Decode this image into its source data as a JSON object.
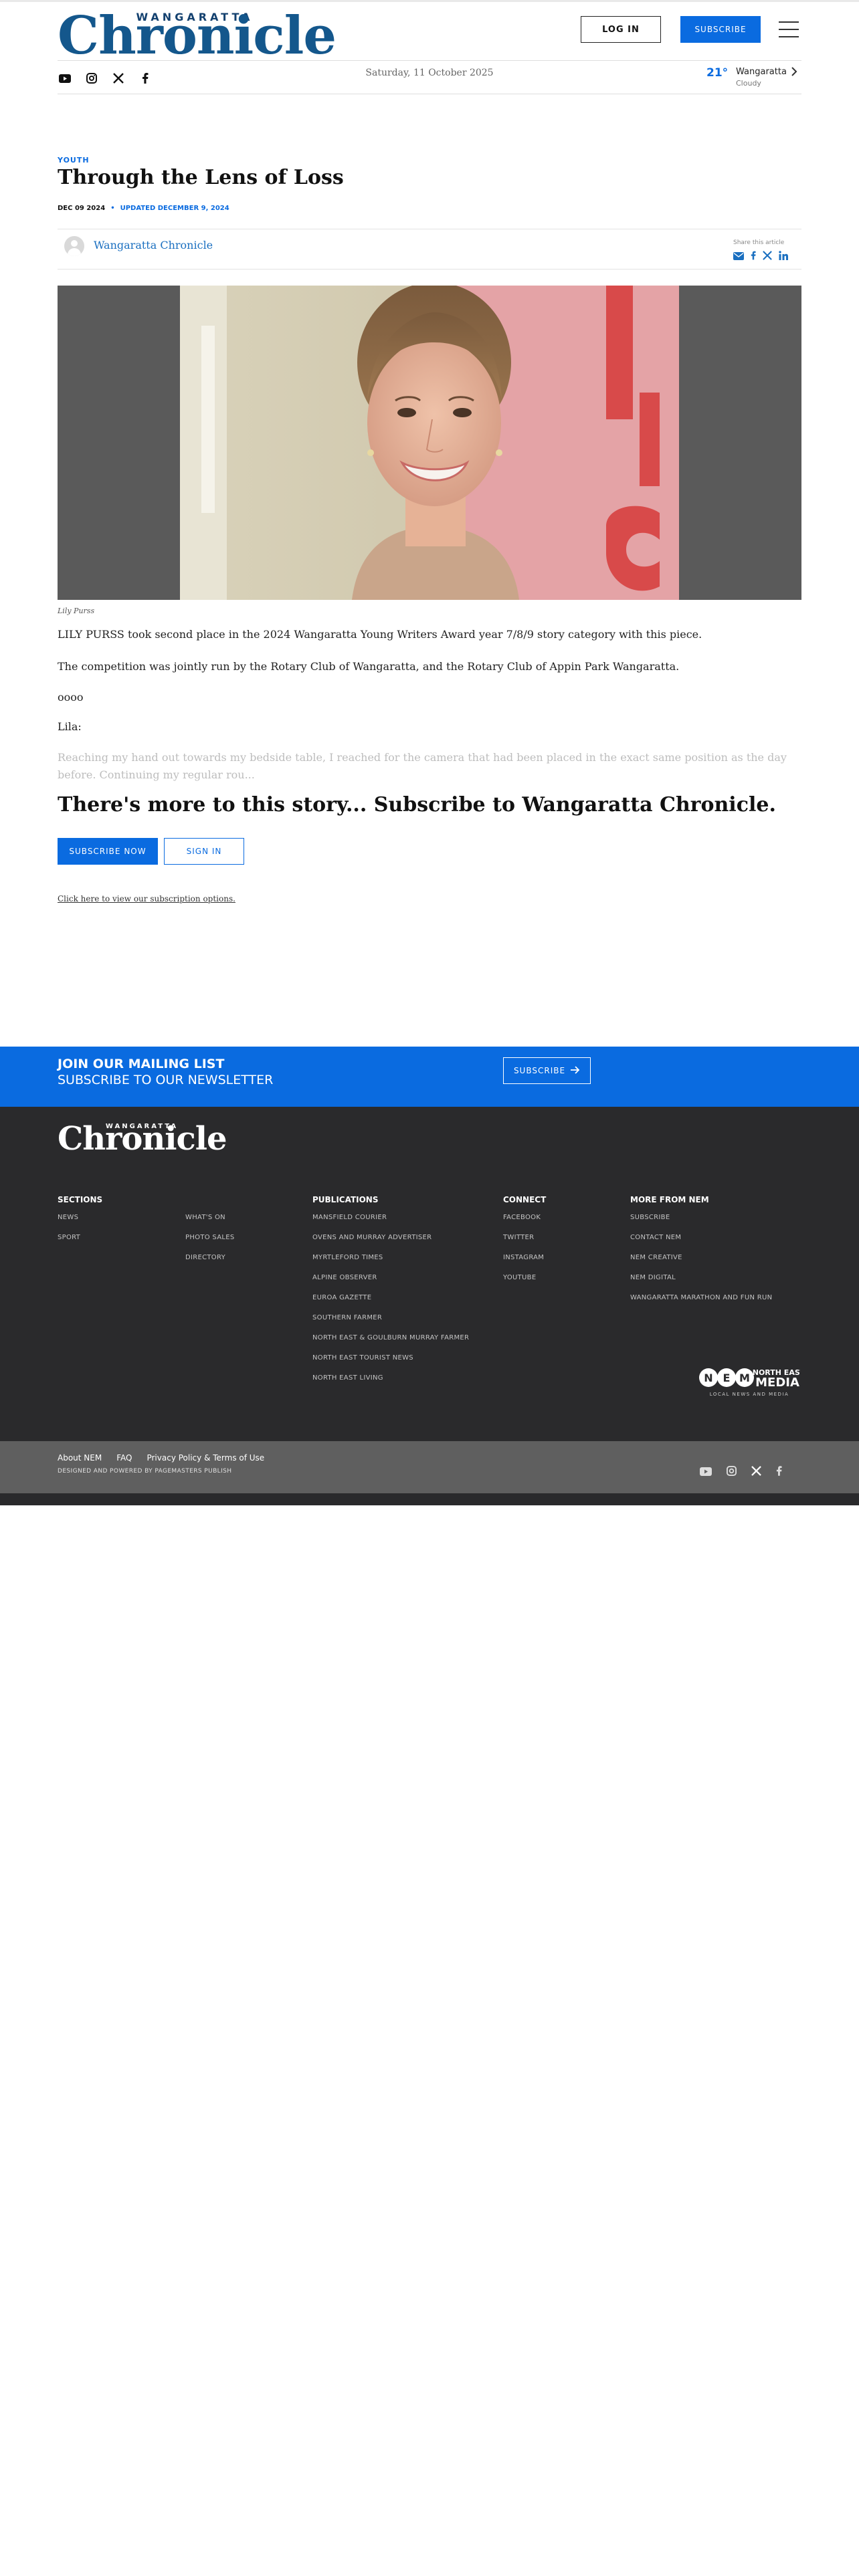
{
  "header": {
    "masthead_kicker": "WANGARATTA",
    "masthead_name": "Chronicle",
    "login_label": "LOG IN",
    "subscribe_label": "SUBSCRIBE",
    "date": "Saturday, 11 October 2025",
    "weather": {
      "temp": "21°",
      "city": "Wangaratta",
      "condition": "Cloudy"
    },
    "social_icons": [
      "youtube-icon",
      "instagram-icon",
      "x-icon",
      "facebook-icon"
    ]
  },
  "article": {
    "category": "YOUTH",
    "title": "Through the Lens of Loss",
    "published": "DEC 09 2024",
    "updated": "UPDATED DECEMBER 9, 2024",
    "author": "Wangaratta Chronicle",
    "share_label": "Share this article",
    "image_caption": "Lily Purss",
    "paragraphs": [
      "LILY PURSS took second place in the 2024 Wangaratta Young Writers Award year 7/8/9 story category with this piece.",
      "The competition was jointly run by the Rotary Club of Wangaratta, and the Rotary Club of Appin Park Wangaratta.",
      "oooo",
      "Lila:"
    ],
    "faded_paragraph": "Reaching my hand out towards my bedside table, I reached for the camera that had been placed in the exact same position as the day before. Continuing my regular rou..."
  },
  "paywall": {
    "title": "There's more to this story... Subscribe to Wangaratta Chronicle.",
    "subscribe_now": "SUBSCRIBE NOW",
    "sign_in": "SIGN IN",
    "options_link": "Click here to view our subscription options."
  },
  "newsletter": {
    "title": "JOIN OUR MAILING LIST",
    "subtitle": "SUBSCRIBE TO OUR NEWSLETTER",
    "button": "SUBSCRIBE"
  },
  "footer": {
    "logo_kicker": "WANGARATTA",
    "logo_name": "Chronicle",
    "sections_title": "SECTIONS",
    "sections_col1": [
      "NEWS",
      "SPORT"
    ],
    "sections_col2": [
      "WHAT'S ON",
      "PHOTO SALES",
      "DIRECTORY"
    ],
    "publications_title": "PUBLICATIONS",
    "publications": [
      "MANSFIELD COURIER",
      "OVENS AND MURRAY ADVERTISER",
      "MYRTLEFORD TIMES",
      "ALPINE OBSERVER",
      "EUROA GAZETTE",
      "SOUTHERN FARMER",
      "NORTH EAST & GOULBURN MURRAY FARMER",
      "NORTH EAST TOURIST NEWS",
      "NORTH EAST LIVING"
    ],
    "connect_title": "CONNECT",
    "connect": [
      "FACEBOOK",
      "TWITTER",
      "INSTAGRAM",
      "YOUTUBE"
    ],
    "more_title": "MORE FROM NEM",
    "more": [
      "SUBSCRIBE",
      "CONTACT NEM",
      "NEM CREATIVE",
      "NEM DIGITAL",
      "WANGARATTA MARATHON AND FUN RUN"
    ],
    "nem_logo_letters": "NEM",
    "nem_logo_line1": "NORTH EAST",
    "nem_logo_line2": "MEDIA",
    "nem_logo_tagline": "LOCAL NEWS AND MEDIA",
    "bar_links": [
      "About NEM",
      "FAQ",
      "Privacy Policy & Terms of Use"
    ],
    "credit": "DESIGNED AND POWERED BY PAGEMASTERS PUBLISH"
  },
  "colors": {
    "accent": "#0a6be0",
    "masthead": "#14578c",
    "footer_bg": "#2a2a2c",
    "footer_bar": "#5f5f5f"
  }
}
